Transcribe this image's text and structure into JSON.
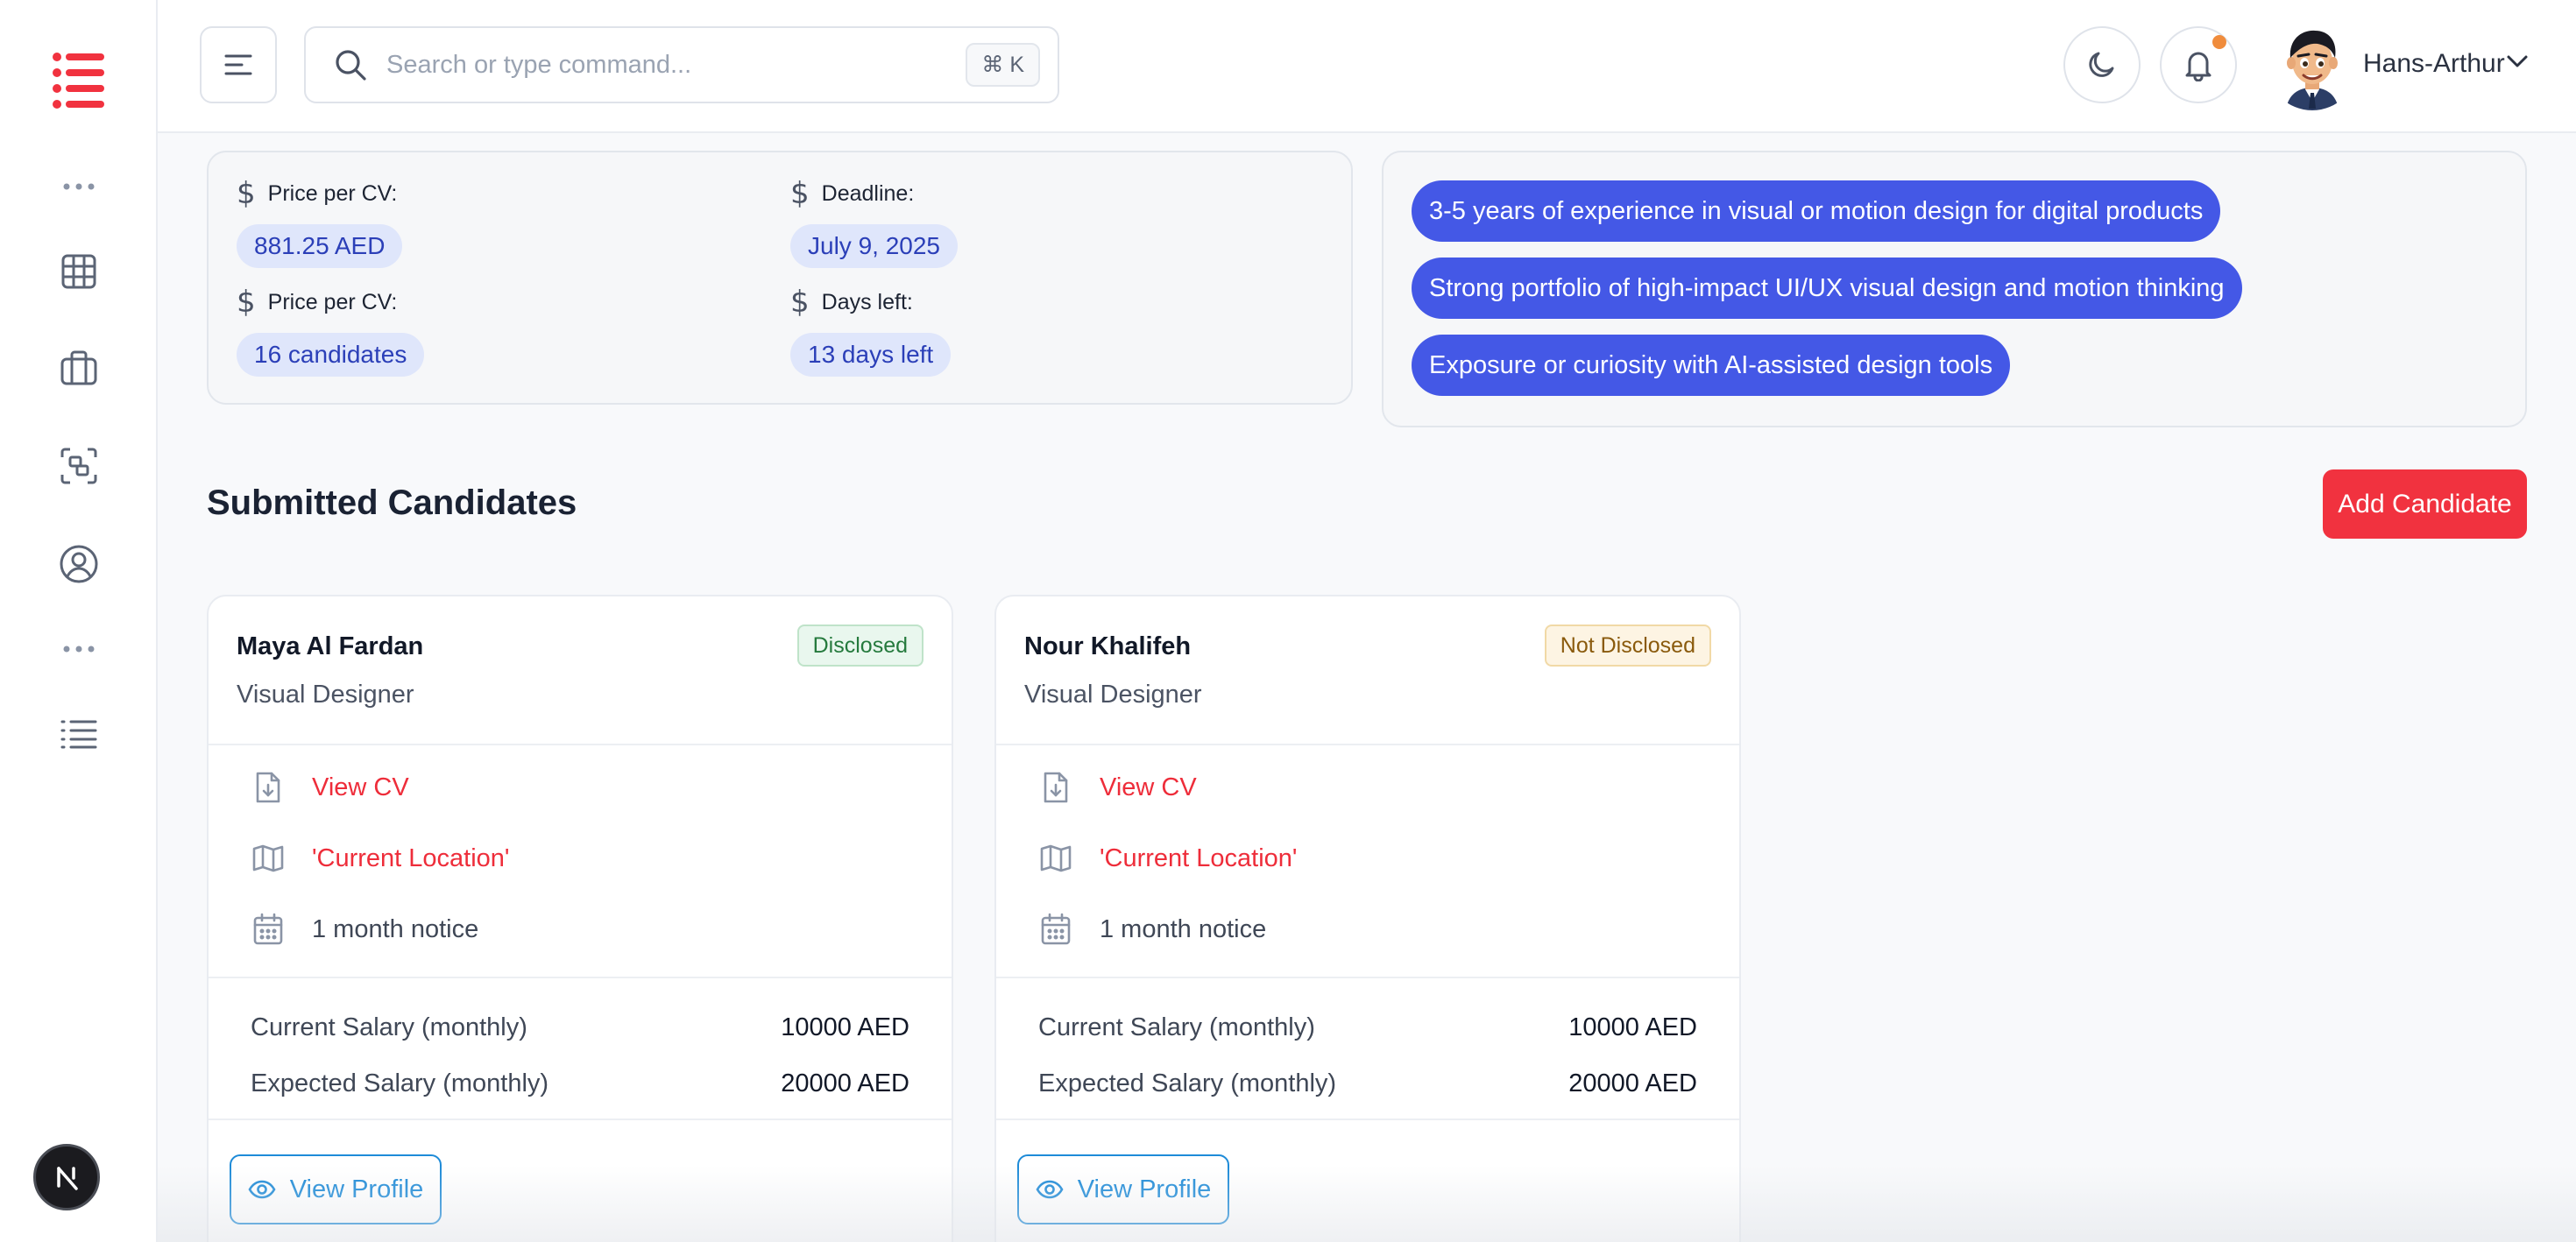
{
  "header": {
    "search_placeholder": "Search or type command...",
    "search_shortcut": "⌘ K",
    "user_name": "Hans-Arthur"
  },
  "job_info": {
    "fields": [
      {
        "label": "Price per CV:",
        "value": "881.25 AED"
      },
      {
        "label": "Deadline:",
        "value": "July 9, 2025"
      },
      {
        "label": "Price per CV:",
        "value": "16 candidates"
      },
      {
        "label": "Days left:",
        "value": "13 days left"
      }
    ]
  },
  "requirements": [
    "3-5 years of experience in visual or motion design for digital products",
    "Strong portfolio of high-impact UI/UX visual design and motion thinking",
    "Exposure or curiosity with AI-assisted design tools"
  ],
  "section": {
    "title": "Submitted Candidates",
    "add_button": "Add Candidate"
  },
  "candidates": [
    {
      "name": "Maya Al Fardan",
      "role": "Visual Designer",
      "status": "Disclosed",
      "view_cv": "View CV",
      "location": "'Current Location'",
      "notice": "1 month notice",
      "current_salary_label": "Current Salary (monthly)",
      "current_salary": "10000 AED",
      "expected_salary_label": "Expected Salary (monthly)",
      "expected_salary": "20000 AED",
      "profile_button": "View Profile"
    },
    {
      "name": "Nour Khalifeh",
      "role": "Visual Designer",
      "status": "Not Disclosed",
      "view_cv": "View CV",
      "location": "'Current Location'",
      "notice": "1 month notice",
      "current_salary_label": "Current Salary (monthly)",
      "current_salary": "10000 AED",
      "expected_salary_label": "Expected Salary (monthly)",
      "expected_salary": "20000 AED",
      "profile_button": "View Profile"
    }
  ],
  "colors": {
    "brand_red": "#f1323f",
    "requirement_tag": "#4458e6",
    "pill_bg": "#dfe6fb",
    "link_blue": "#1e8bd8"
  }
}
